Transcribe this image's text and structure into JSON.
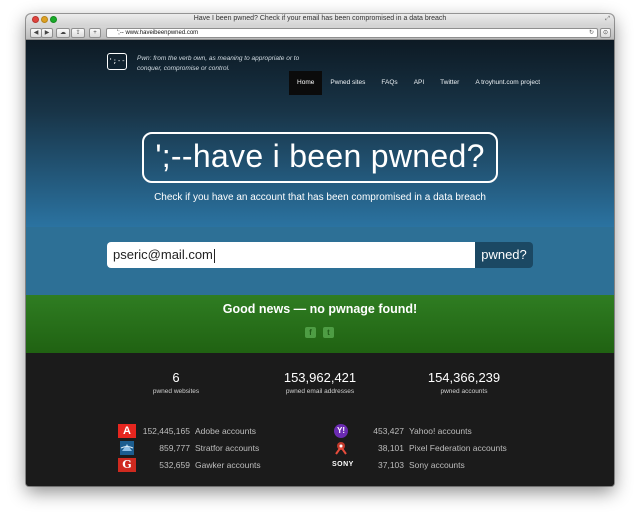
{
  "window": {
    "title": "Have I been pwned? Check if your email has been compromised in a data breach",
    "url": "';-- www.haveibeenpwned.com"
  },
  "site": {
    "logo_text": "';--",
    "tagline": "Pwn: from the verb own, as meaning to appropriate or to conquer, compromise or control.",
    "nav": [
      "Home",
      "Pwned sites",
      "FAQs",
      "API",
      "Twitter",
      "A troyhunt.com project"
    ],
    "active_nav": "Home",
    "banner": "';--have i been pwned?",
    "subtitle": "Check if you have an account that has been compromised in a data breach",
    "search": {
      "value": "pseric@mail.com",
      "button": "pwned?"
    },
    "result": {
      "message": "Good news — no pwnage found!",
      "social": [
        "facebook-icon",
        "twitter-icon"
      ]
    },
    "stats": [
      {
        "value": "6",
        "label": "pwned websites"
      },
      {
        "value": "153,962,421",
        "label": "pwned email addresses"
      },
      {
        "value": "154,366,239",
        "label": "pwned accounts"
      }
    ],
    "breaches": [
      {
        "count": "152,445,165",
        "name": "Adobe accounts",
        "icon": "adobe-icon"
      },
      {
        "count": "859,777",
        "name": "Stratfor accounts",
        "icon": "stratfor-icon"
      },
      {
        "count": "532,659",
        "name": "Gawker accounts",
        "icon": "gawker-icon"
      },
      {
        "count": "453,427",
        "name": "Yahoo! accounts",
        "icon": "yahoo-icon"
      },
      {
        "count": "38,101",
        "name": "Pixel Federation accounts",
        "icon": "pixel-federation-icon"
      },
      {
        "count": "37,103",
        "name": "Sony accounts",
        "icon": "sony-icon"
      }
    ],
    "icon_text": {
      "adobe": "A",
      "gawker": "G",
      "yahoo": "Y!",
      "sony": "SONY",
      "facebook": "f",
      "twitter": "t"
    },
    "colors": {
      "result_green": "#2f7d22",
      "search_band": "#2d7096",
      "search_button": "#1b4863",
      "adobe_red": "#e6261f",
      "yahoo_purple": "#6b2bb1"
    }
  }
}
